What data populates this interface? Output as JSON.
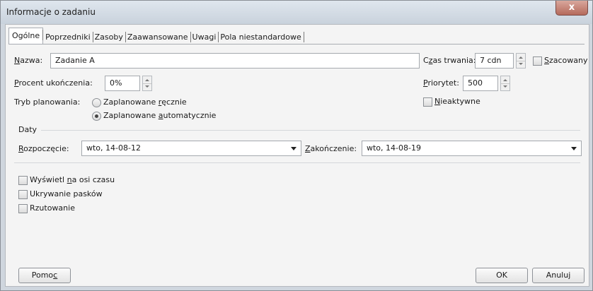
{
  "window": {
    "title": "Informacje o zadaniu",
    "close_label": "x"
  },
  "tabs": [
    {
      "label": "Ogólne",
      "active": true
    },
    {
      "label": "Poprzedniki"
    },
    {
      "label": "Zasoby"
    },
    {
      "label": "Zaawansowane"
    },
    {
      "label": "Uwagi"
    },
    {
      "label": "Pola niestandardowe"
    }
  ],
  "general": {
    "name_label_underlined": "N",
    "name_label_rest": "azwa:",
    "name_value": "Zadanie A",
    "duration_label_a": "C",
    "duration_label_u": "z",
    "duration_label_b": "as trwania:",
    "duration_value": "7 cdn",
    "estimated_label_u": "S",
    "estimated_label_rest": "zacowany",
    "percent_label_u": "P",
    "percent_label_rest": "rocent ukończenia:",
    "percent_value": "0%",
    "priority_label_u": "P",
    "priority_label_rest": "riorytet:",
    "priority_value": "500",
    "mode_label": "Tryb planowania:",
    "mode_manual_a": "Zaplanowane ",
    "mode_manual_u": "r",
    "mode_manual_b": "ęcznie",
    "mode_auto_a": "Zaplanowane ",
    "mode_auto_u": "a",
    "mode_auto_b": "utomatycznie",
    "inactive_label_u": "N",
    "inactive_label_rest": "ieaktywne"
  },
  "dates": {
    "section_label": "Daty",
    "start_label_u": "R",
    "start_label_rest": "ozpoczęcie:",
    "start_value": "wto, 14-08-12",
    "finish_label_u": "Z",
    "finish_label_rest": "akończenie:",
    "finish_value": "wto, 14-08-19"
  },
  "options": {
    "timeline_a": "Wyświetl ",
    "timeline_u": "n",
    "timeline_b": "a osi czasu",
    "hide_bars": "Ukrywanie pasków",
    "rollup": "Rzutowanie"
  },
  "buttons": {
    "help_a": "Pomo",
    "help_u": "c",
    "ok": "OK",
    "cancel": "Anuluj"
  }
}
